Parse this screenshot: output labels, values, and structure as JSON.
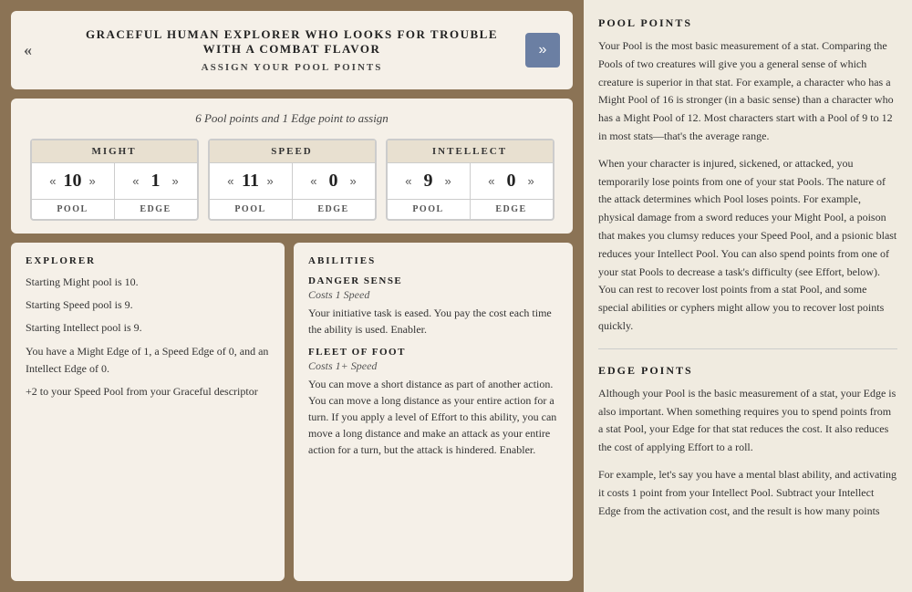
{
  "header": {
    "title": "Graceful Human Explorer Who Looks for Trouble with a Combat Flavor",
    "subtitle": "Assign Your Pool Points",
    "nav_left": "«",
    "nav_right": "»"
  },
  "pool_points_label": "6 Pool points and 1 Edge point to assign",
  "stats": [
    {
      "name": "MIGHT",
      "pool": 10,
      "edge": 1,
      "pool_label": "POOL",
      "edge_label": "EDGE"
    },
    {
      "name": "SPEED",
      "pool": 11,
      "edge": 0,
      "pool_label": "POOL",
      "edge_label": "EDGE"
    },
    {
      "name": "INTELLECT",
      "pool": 9,
      "edge": 0,
      "pool_label": "POOL",
      "edge_label": "EDGE"
    }
  ],
  "explorer": {
    "title": "EXPLORER",
    "lines": [
      "Starting Might pool is 10.",
      "Starting Speed pool is 9.",
      "Starting Intellect pool is 9.",
      "",
      "You have a Might Edge of 1, a Speed Edge of 0, and an Intellect Edge of 0.",
      "",
      "+2 to your Speed Pool from your Graceful descriptor"
    ]
  },
  "abilities": {
    "title": "ABILITIES",
    "items": [
      {
        "name": "DANGER SENSE",
        "cost": "Costs 1 Speed",
        "desc": "Your initiative task is eased. You pay the cost each time the ability is used. Enabler."
      },
      {
        "name": "FLEET OF FOOT",
        "cost": "Costs 1+ Speed",
        "desc": "You can move a short distance as part of another action. You can move a long distance as your entire action for a turn. If you apply a level of Effort to this ability, you can move a long distance and make an attack as your entire action for a turn, but the attack is hindered. Enabler."
      }
    ]
  },
  "sidebar": {
    "pool_points_title": "POOL POINTS",
    "pool_points_text_1": "Your Pool is the most basic measurement of a stat. Comparing the Pools of two creatures will give you a general sense of which creature is superior in that stat. For example, a character who has a Might Pool of 16 is stronger (in a basic sense) than a character who has a Might Pool of 12. Most characters start with a Pool of 9 to 12 in most stats—that's the average range.",
    "pool_points_text_2": "When your character is injured, sickened, or attacked, you temporarily lose points from one of your stat Pools. The nature of the attack determines which Pool loses points. For example, physical damage from a sword reduces your Might Pool, a poison that makes you clumsy reduces your Speed Pool, and a psionic blast reduces your Intellect Pool. You can also spend points from one of your stat Pools to decrease a task's difficulty (see Effort, below). You can rest to recover lost points from a stat Pool, and some special abilities or cyphers might allow you to recover lost points quickly.",
    "edge_points_title": "EDGE POINTS",
    "edge_points_text_1": "Although your Pool is the basic measurement of a stat, your Edge is also important. When something requires you to spend points from a stat Pool, your Edge for that stat reduces the cost. It also reduces the cost of applying Effort to a roll.",
    "edge_points_text_2": "For example, let's say you have a mental blast ability, and activating it costs 1 point from your Intellect Pool. Subtract your Intellect Edge from the activation cost, and the result is how many points"
  }
}
